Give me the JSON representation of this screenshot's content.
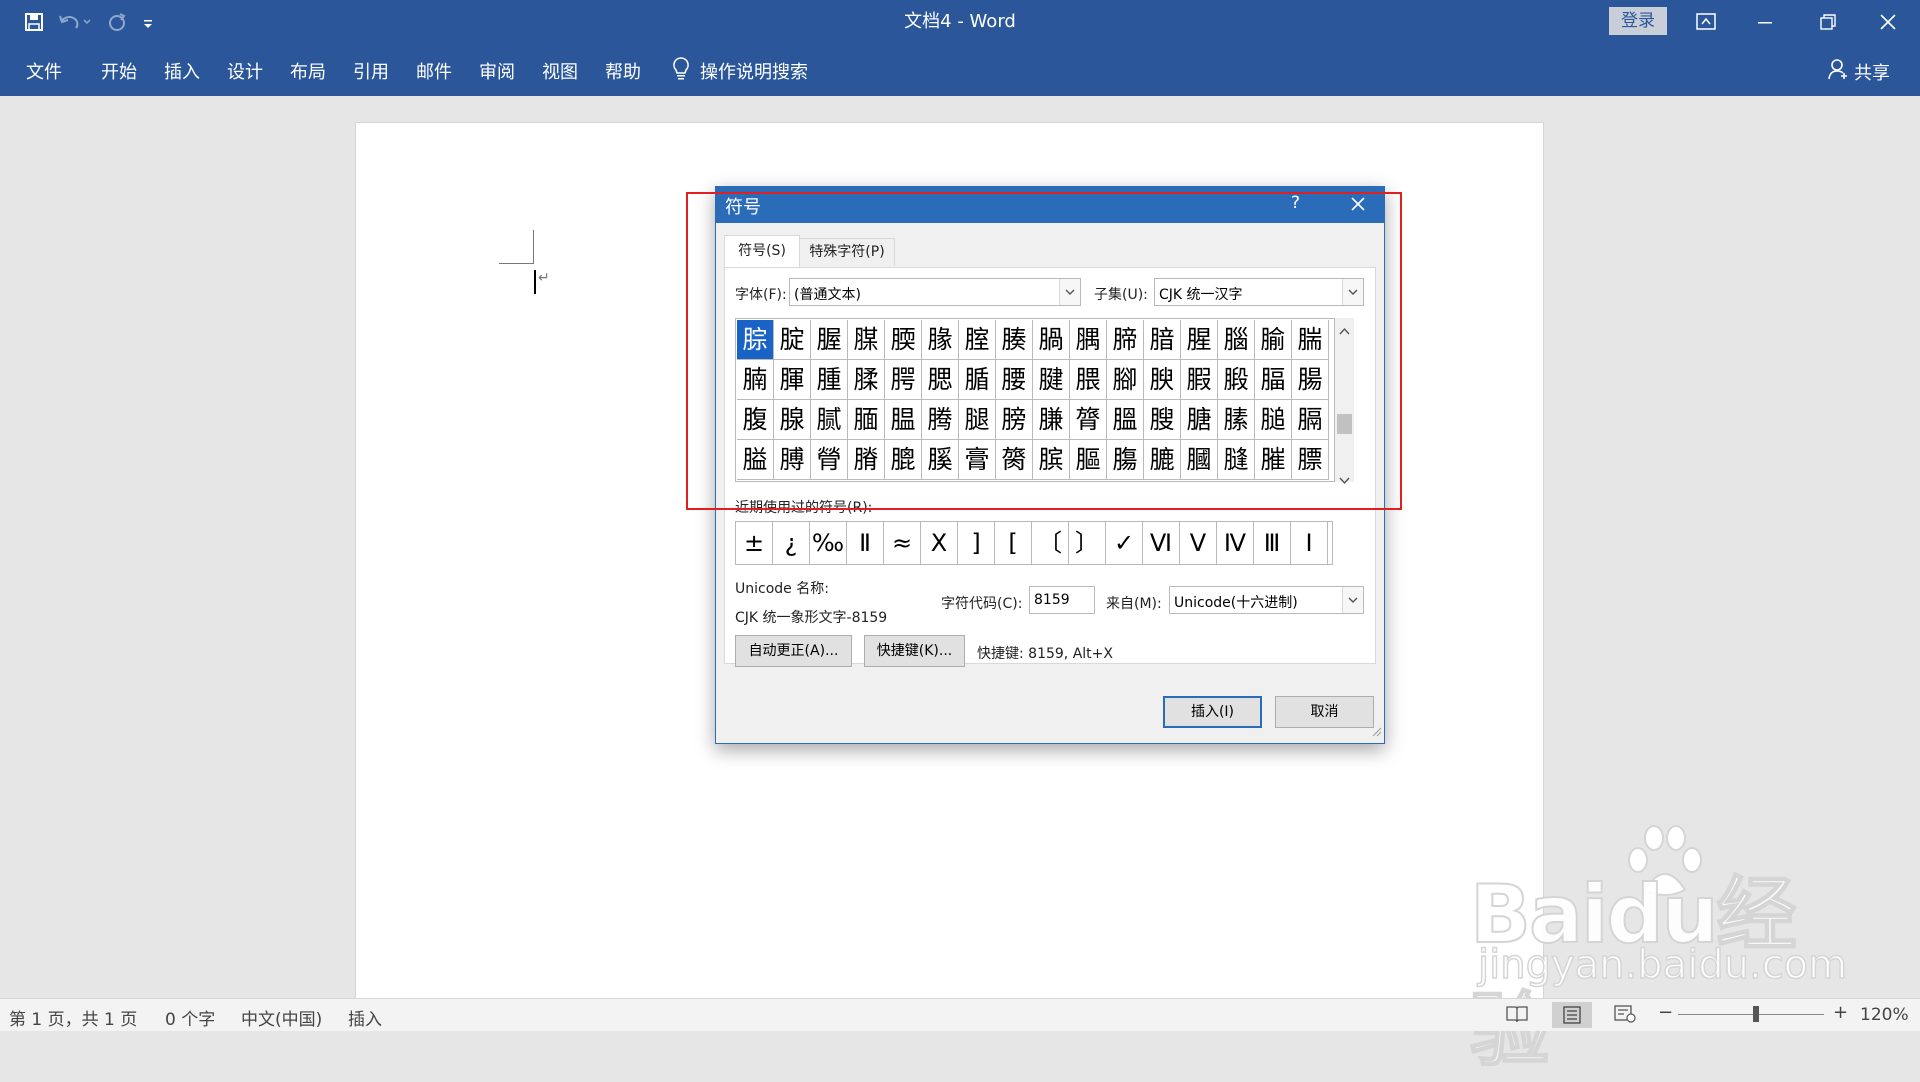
{
  "titlebar": {
    "doc_title": "文档4  -  Word",
    "login_label": "登录"
  },
  "ribbon": {
    "tabs": [
      "文件",
      "开始",
      "插入",
      "设计",
      "布局",
      "引用",
      "邮件",
      "审阅",
      "视图",
      "帮助"
    ],
    "search_label": "操作说明搜索",
    "share_label": "共享"
  },
  "dialog": {
    "title": "符号",
    "help": "?",
    "tab_symbols": "符号(S)",
    "tab_special": "特殊字符(P)",
    "font_label": "字体(F):",
    "font_value": "(普通文本)",
    "subset_label": "子集(U):",
    "subset_value": "CJK 统一汉字",
    "symbols": [
      [
        "腙",
        "腚",
        "腛",
        "腜",
        "腝",
        "腞",
        "腟",
        "腠",
        "腡",
        "腢",
        "腣",
        "腤",
        "腥",
        "腦",
        "腧",
        "腨"
      ],
      [
        "腩",
        "腪",
        "腫",
        "腬",
        "腭",
        "腮",
        "腯",
        "腰",
        "腱",
        "腲",
        "腳",
        "腴",
        "腵",
        "腶",
        "腷",
        "腸"
      ],
      [
        "腹",
        "腺",
        "腻",
        "腼",
        "腽",
        "腾",
        "腿",
        "膀",
        "膁",
        "膂",
        "膃",
        "膄",
        "膅",
        "膆",
        "膇",
        "膈"
      ],
      [
        "膉",
        "膊",
        "膋",
        "膌",
        "膍",
        "膎",
        "膏",
        "膐",
        "膑",
        "膒",
        "膓",
        "膔",
        "膕",
        "膖",
        "膗",
        "膘"
      ]
    ],
    "recent_label": "近期使用过的符号(R):",
    "recent_symbols": [
      "±",
      "¿",
      "‰",
      "Ⅱ",
      "≈",
      "Х",
      "]",
      "[",
      "〔",
      "〕",
      "✓",
      "Ⅵ",
      "Ⅴ",
      "Ⅳ",
      "Ⅲ",
      "Ⅰ"
    ],
    "unicode_name_label": "Unicode 名称:",
    "unicode_name_value": "CJK 统一象形文字-8159",
    "char_code_label": "字符代码(C):",
    "char_code_value": "8159",
    "from_label": "来自(M):",
    "from_value": "Unicode(十六进制)",
    "autocorrect_btn": "自动更正(A)...",
    "shortcut_btn": "快捷键(K)...",
    "shortcut_text": "快捷键: 8159, Alt+X",
    "insert_btn": "插入(I)",
    "cancel_btn": "取消"
  },
  "statusbar": {
    "page": "第 1 页，共 1 页",
    "words": "0 个字",
    "language": "中文(中国)",
    "mode": "插入",
    "zoom": "120%"
  },
  "watermark": {
    "brand": "Baidu经验",
    "url": "jingyan.baidu.com"
  },
  "colors": {
    "ribbon": "#2b579a",
    "dialog_title": "#2b6cb8",
    "selection": "#1a63c6",
    "highlight_box": "#e02020"
  }
}
